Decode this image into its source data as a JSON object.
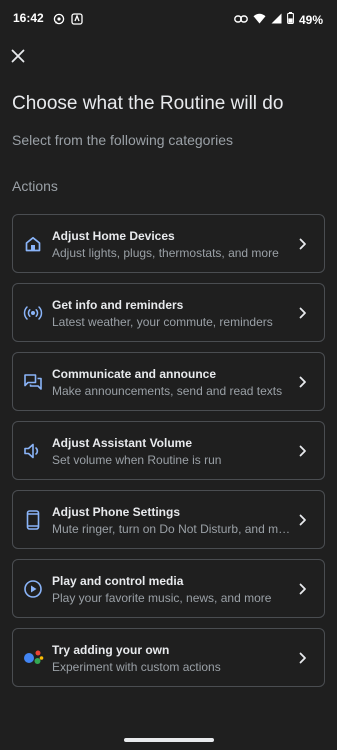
{
  "status_bar": {
    "time": "16:42",
    "battery": "49%",
    "icons": [
      "whatsapp-icon",
      "app-notification-icon",
      "link-icon",
      "wifi-icon",
      "signal-icon",
      "battery-icon"
    ]
  },
  "header": {
    "close_icon": "close-icon",
    "title": "Choose what the Routine will do",
    "subtitle": "Select from the following categories"
  },
  "section": {
    "label": "Actions"
  },
  "categories": [
    {
      "title": "Adjust Home Devices",
      "description": "Adjust lights, plugs, thermostats, and more",
      "icon": "home-icon"
    },
    {
      "title": "Get info and reminders",
      "description": "Latest weather, your commute, reminders",
      "icon": "broadcast-icon"
    },
    {
      "title": "Communicate and announce",
      "description": "Make announcements, send and read texts",
      "icon": "chat-icon"
    },
    {
      "title": "Adjust Assistant Volume",
      "description": "Set volume when Routine is run",
      "icon": "volume-icon"
    },
    {
      "title": "Adjust Phone Settings",
      "description": "Mute ringer, turn on Do Not Disturb, and more",
      "icon": "phone-icon"
    },
    {
      "title": "Play and control media",
      "description": "Play your favorite music, news, and more",
      "icon": "play-circle-icon"
    },
    {
      "title": "Try adding your own",
      "description": "Experiment with custom actions",
      "icon": "assistant-icon"
    }
  ],
  "colors": {
    "background": "#1f1f1f",
    "card_border": "#4a4d51",
    "icon_accent": "#8ab4f8",
    "primary_text": "#e8eaed",
    "secondary_text": "#9aa0a6"
  }
}
